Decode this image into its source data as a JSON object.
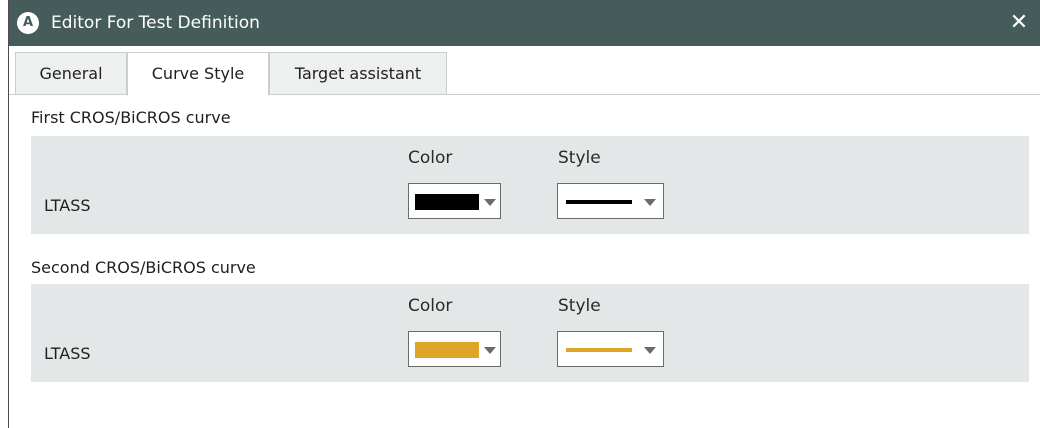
{
  "window": {
    "icon_letter": "A",
    "title": "Editor For Test Definition",
    "close_glyph": "✕"
  },
  "tabs": [
    {
      "label": "General",
      "active": false
    },
    {
      "label": "Curve Style",
      "active": true
    },
    {
      "label": "Target assistant",
      "active": false
    }
  ],
  "sections": [
    {
      "title": "First CROS/BiCROS curve",
      "color_header": "Color",
      "style_header": "Style",
      "row_label": "LTASS",
      "color_value": "#000000",
      "style_color": "#000000",
      "style_type": "solid"
    },
    {
      "title": "Second CROS/BiCROS curve",
      "color_header": "Color",
      "style_header": "Style",
      "row_label": "LTASS",
      "color_value": "#e0a526",
      "style_color": "#e0a526",
      "style_type": "solid"
    }
  ],
  "colors": {
    "titlebar": "#465c5b",
    "panel": "#e4e7e7"
  },
  "icons": {
    "app": "letter-a-circle-icon",
    "close": "close-icon",
    "dropdown": "caret-down-icon"
  }
}
